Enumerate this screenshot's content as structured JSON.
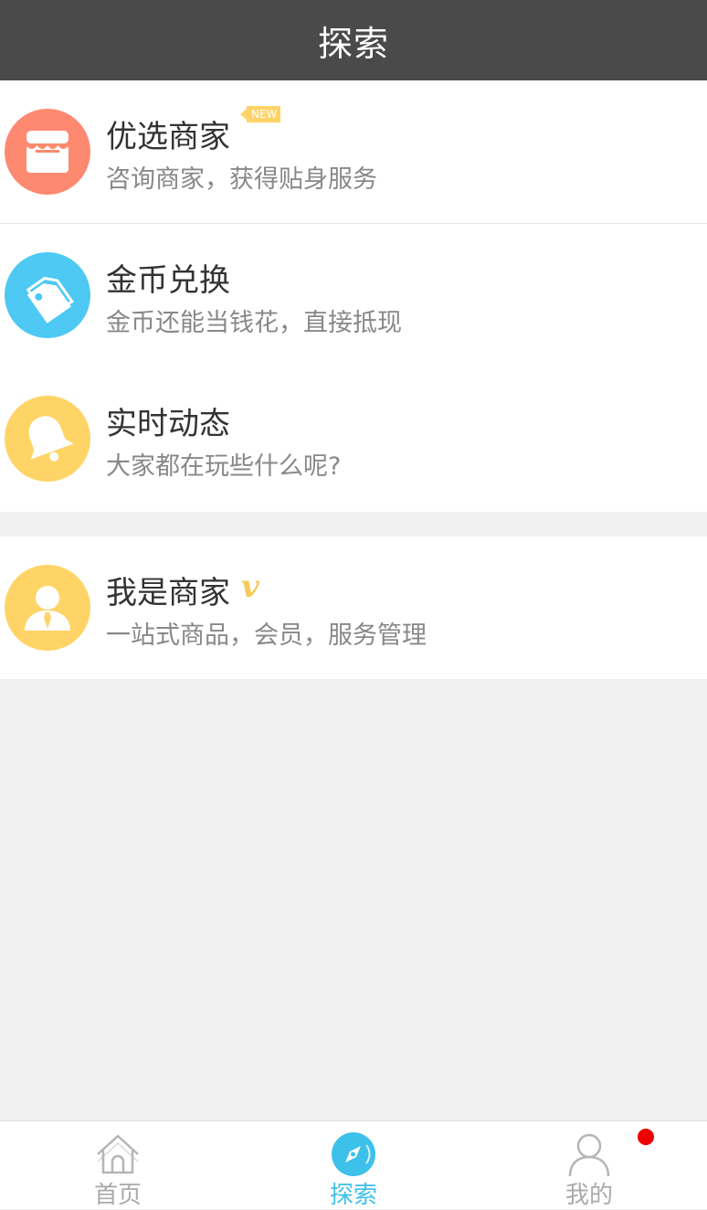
{
  "header": {
    "title": "探索"
  },
  "items": [
    {
      "title": "优选商家",
      "subtitle": "咨询商家，获得贴身服务",
      "badge": "NEW",
      "icon": "store-icon",
      "color": "#fd8a70"
    },
    {
      "title": "金币兑换",
      "subtitle": "金币还能当钱花，直接抵现",
      "icon": "tag-icon",
      "color": "#4dc9f3"
    },
    {
      "title": "实时动态",
      "subtitle": "大家都在玩些什么呢?",
      "icon": "bell-icon",
      "color": "#ffd466"
    },
    {
      "title": "我是商家",
      "subtitle": "一站式商品，会员，服务管理",
      "badge": "v",
      "icon": "merchant-icon",
      "color": "#ffd466"
    }
  ],
  "tabbar": {
    "tabs": [
      {
        "label": "首页",
        "icon": "home-icon",
        "active": false
      },
      {
        "label": "探索",
        "icon": "compass-icon",
        "active": true
      },
      {
        "label": "我的",
        "icon": "user-icon",
        "active": false,
        "notification_dot": true
      }
    ]
  },
  "colors": {
    "header_bg": "#4a4a4a",
    "page_bg": "#f1f0f1",
    "accent": "#3dc0ea",
    "notification": "#ee0000"
  }
}
